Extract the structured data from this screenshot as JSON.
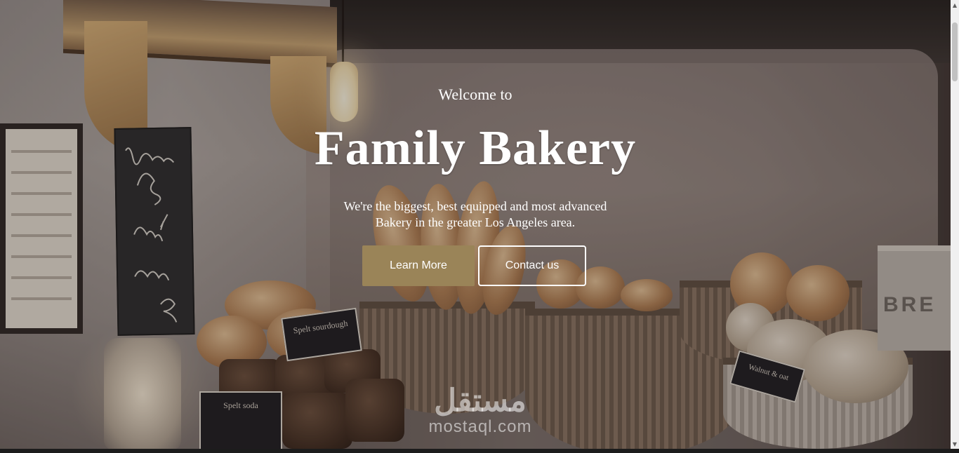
{
  "hero": {
    "welcome": "Welcome to",
    "title": "Family Bakery",
    "tagline": "We're the biggest, best equipped and most advanced Bakery in the greater Los Angeles area."
  },
  "buttons": {
    "learn_more": "Learn More",
    "contact_us": "Contact us"
  },
  "background": {
    "chalkboard_text": "Loaf Too Big? Any 1/2 Loaf £2",
    "sign_spelt_sourdough": "Spelt sourdough",
    "sign_spelt_soda": "Spelt soda",
    "sign_walnut": "Walnut & oat",
    "box_lettering": "BRE"
  },
  "watermark": {
    "arabic": "مستقل",
    "latin": "mostaql.com"
  },
  "colors": {
    "accent": "#9a8458",
    "text": "#ffffff",
    "button_border": "#ffffff"
  }
}
